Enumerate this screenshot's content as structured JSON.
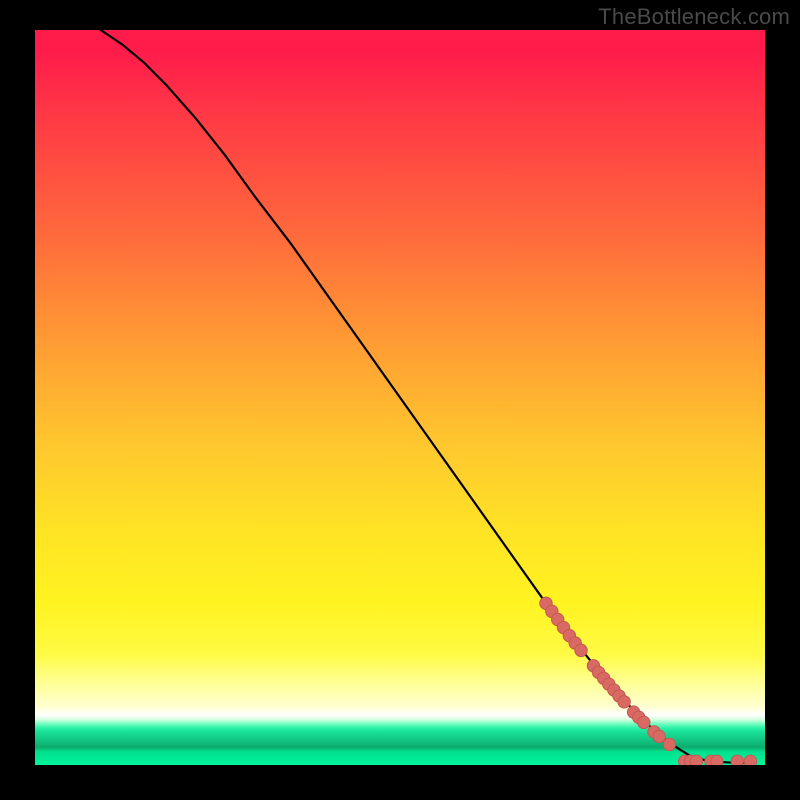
{
  "watermark": "TheBottleneck.com",
  "colors": {
    "bg_black": "#000000",
    "curve": "#000000",
    "marker_fill": "#d96a63",
    "marker_stroke": "#c45852"
  },
  "chart_data": {
    "type": "line",
    "title": "",
    "xlabel": "",
    "ylabel": "",
    "xlim": [
      0,
      100
    ],
    "ylim": [
      0,
      100
    ],
    "grid": false,
    "series": [
      {
        "name": "curve",
        "x": [
          9,
          12,
          15,
          18,
          22,
          26,
          30,
          35,
          40,
          45,
          50,
          55,
          60,
          65,
          70,
          73,
          76,
          79,
          82,
          84.5,
          86.5,
          88.5,
          90,
          92,
          94,
          96,
          98
        ],
        "y": [
          100,
          98,
          95.5,
          92.5,
          88,
          83,
          77.5,
          71,
          64,
          57,
          50,
          43,
          36,
          29,
          22,
          18,
          14.3,
          10.8,
          7.4,
          5.0,
          3.3,
          2.0,
          1.1,
          0.6,
          0.4,
          0.3,
          0.3
        ]
      }
    ],
    "markers": [
      {
        "x": 70.0,
        "y": 22.0
      },
      {
        "x": 70.8,
        "y": 20.9
      },
      {
        "x": 71.6,
        "y": 19.8
      },
      {
        "x": 72.4,
        "y": 18.7
      },
      {
        "x": 73.2,
        "y": 17.6
      },
      {
        "x": 74.0,
        "y": 16.6
      },
      {
        "x": 74.8,
        "y": 15.6
      },
      {
        "x": 76.5,
        "y": 13.5
      },
      {
        "x": 77.2,
        "y": 12.6
      },
      {
        "x": 77.9,
        "y": 11.8
      },
      {
        "x": 78.6,
        "y": 11.0
      },
      {
        "x": 79.3,
        "y": 10.2
      },
      {
        "x": 80.0,
        "y": 9.4
      },
      {
        "x": 80.7,
        "y": 8.6
      },
      {
        "x": 82.0,
        "y": 7.2
      },
      {
        "x": 82.7,
        "y": 6.5
      },
      {
        "x": 83.4,
        "y": 5.8
      },
      {
        "x": 84.8,
        "y": 4.5
      },
      {
        "x": 85.5,
        "y": 3.9
      },
      {
        "x": 86.9,
        "y": 2.8
      },
      {
        "x": 89.0,
        "y": 0.5
      },
      {
        "x": 89.8,
        "y": 0.5
      },
      {
        "x": 90.6,
        "y": 0.5
      },
      {
        "x": 92.6,
        "y": 0.5
      },
      {
        "x": 93.4,
        "y": 0.5
      },
      {
        "x": 96.2,
        "y": 0.5
      },
      {
        "x": 98.0,
        "y": 0.5
      }
    ]
  }
}
